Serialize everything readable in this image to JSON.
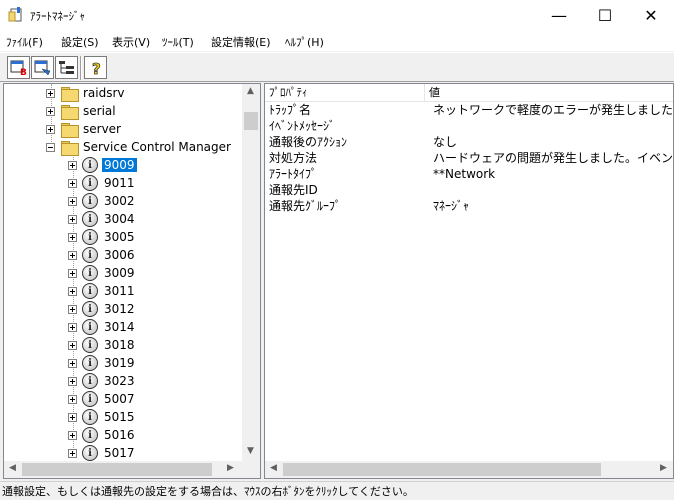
{
  "window": {
    "title": "ｱﾗｰﾄﾏﾈｰｼﾞｬ",
    "minimize_glyph": "—",
    "maximize_glyph": "☐",
    "close_glyph": "✕"
  },
  "menu": [
    {
      "label": "ﾌｧｲﾙ(F)"
    },
    {
      "label": "設定(S)"
    },
    {
      "label": "表示(V)"
    },
    {
      "label": "ﾂｰﾙ(T)"
    },
    {
      "label": "設定情報(E)"
    },
    {
      "label": "ﾍﾙﾌﾟ(H)"
    }
  ],
  "toolbar": {
    "help_glyph": "?"
  },
  "tree": {
    "folders": [
      {
        "label": "raidsrv"
      },
      {
        "label": "serial"
      },
      {
        "label": "server"
      },
      {
        "label": "Service Control Manager"
      }
    ],
    "items": [
      {
        "label": "9009"
      },
      {
        "label": "9011"
      },
      {
        "label": "3002"
      },
      {
        "label": "3004"
      },
      {
        "label": "3005"
      },
      {
        "label": "3006"
      },
      {
        "label": "3009"
      },
      {
        "label": "3011"
      },
      {
        "label": "3012"
      },
      {
        "label": "3014"
      },
      {
        "label": "3018"
      },
      {
        "label": "3019"
      },
      {
        "label": "3023"
      },
      {
        "label": "5007"
      },
      {
        "label": "5015"
      },
      {
        "label": "5016"
      },
      {
        "label": "5017"
      }
    ],
    "info_glyph": "i"
  },
  "list": {
    "headers": {
      "property": "ﾌﾟﾛﾊﾟﾃｨ",
      "value": "値"
    },
    "rows": [
      {
        "property": "ﾄﾗｯﾌﾟ名",
        "value": "ネットワークで軽度のエラーが発生しました"
      },
      {
        "property": "ｲﾍﾞﾝﾄﾒｯｾｰｼﾞ",
        "value": ""
      },
      {
        "property": "通報後のｱｸｼｮﾝ",
        "value": "なし"
      },
      {
        "property": "対処方法",
        "value": "ハードウェアの問題が発生しました。イベントビューアで"
      },
      {
        "property": "ｱﾗｰﾄﾀｲﾌﾟ",
        "value": "**Network"
      },
      {
        "property": "通報先ID",
        "value": ""
      },
      {
        "property": "通報先ｸﾞﾙｰﾌﾟ",
        "value": "ﾏﾈｰｼﾞｬ"
      }
    ]
  },
  "scroll": {
    "up": "▲",
    "down": "▼",
    "left": "◀",
    "right": "▶"
  },
  "status": {
    "text": "通報設定、もしくは通報先の設定をする場合は、ﾏｳｽの右ﾎﾞﾀﾝをｸﾘｯｸしてください。"
  }
}
